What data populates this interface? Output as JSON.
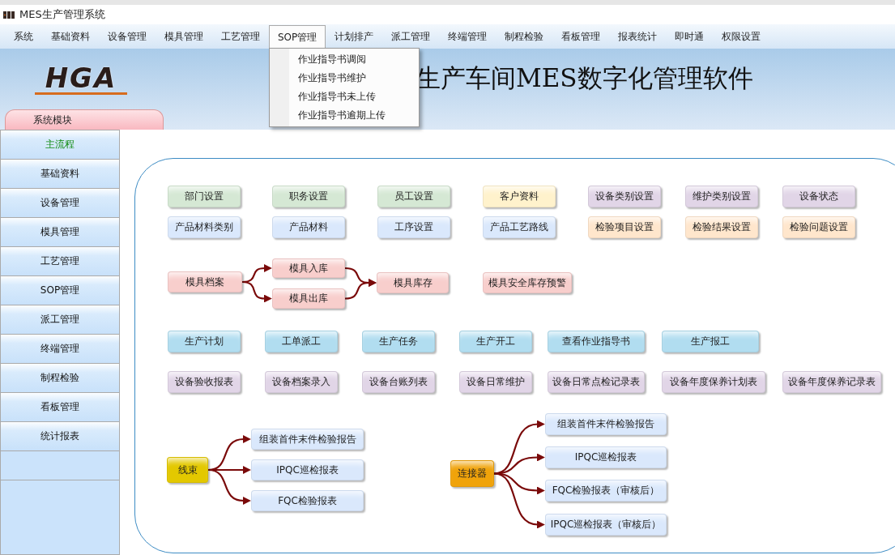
{
  "window": {
    "title": "MES生产管理系统"
  },
  "menu": [
    {
      "label": "系统",
      "selected": false
    },
    {
      "label": "基础资料",
      "selected": false
    },
    {
      "label": "设备管理",
      "selected": false
    },
    {
      "label": "模具管理",
      "selected": false
    },
    {
      "label": "工艺管理",
      "selected": false
    },
    {
      "label": "SOP管理",
      "selected": true
    },
    {
      "label": "计划排产",
      "selected": false
    },
    {
      "label": "派工管理",
      "selected": false
    },
    {
      "label": "终端管理",
      "selected": false
    },
    {
      "label": "制程检验",
      "selected": false
    },
    {
      "label": "看板管理",
      "selected": false
    },
    {
      "label": "报表统计",
      "selected": false
    },
    {
      "label": "即时通",
      "selected": false
    },
    {
      "label": "权限设置",
      "selected": false
    }
  ],
  "dropdown": [
    "作业指导书调阅",
    "作业指导书维护",
    "作业指导书未上传",
    "作业指导书逾期上传"
  ],
  "banner": {
    "logo": "HGA",
    "title": "生产车间MES数字化管理软件"
  },
  "module_tab": "系统模块",
  "sidebar": [
    {
      "label": "主流程",
      "selected": true
    },
    {
      "label": "基础资料",
      "selected": false
    },
    {
      "label": "设备管理",
      "selected": false
    },
    {
      "label": "模具管理",
      "selected": false
    },
    {
      "label": "工艺管理",
      "selected": false
    },
    {
      "label": "SOP管理",
      "selected": false
    },
    {
      "label": "派工管理",
      "selected": false
    },
    {
      "label": "终端管理",
      "selected": false
    },
    {
      "label": "制程检验",
      "selected": false
    },
    {
      "label": "看板管理",
      "selected": false
    },
    {
      "label": "统计报表",
      "selected": false
    }
  ],
  "grid_rows": [
    [
      {
        "label": "部门设置",
        "color": "#d5e8d4"
      },
      {
        "label": "职务设置",
        "color": "#d5e8d4"
      },
      {
        "label": "员工设置",
        "color": "#d5e8d4"
      },
      {
        "label": "客户资料",
        "color": "#fff2cc"
      },
      {
        "label": "设备类别设置",
        "color": "#e1d5e7"
      },
      {
        "label": "维护类别设置",
        "color": "#e1d5e7"
      },
      {
        "label": "设备状态",
        "color": "#e1d5e7"
      }
    ],
    [
      {
        "label": "产品材料类别",
        "color": "#dae8fc"
      },
      {
        "label": "产品材料",
        "color": "#dae8fc"
      },
      {
        "label": "工序设置",
        "color": "#dae8fc"
      },
      {
        "label": "产品工艺路线",
        "color": "#dae8fc"
      },
      {
        "label": "检验项目设置",
        "color": "#ffe6cc"
      },
      {
        "label": "检验结果设置",
        "color": "#ffe6cc"
      },
      {
        "label": "检验问题设置",
        "color": "#ffe6cc"
      }
    ],
    [
      {
        "label": "生产计划",
        "color": "#b1ddf0"
      },
      {
        "label": "工单派工",
        "color": "#b1ddf0"
      },
      {
        "label": "生产任务",
        "color": "#b1ddf0"
      },
      {
        "label": "生产开工",
        "color": "#b1ddf0"
      },
      {
        "label": "查看作业指导书",
        "color": "#b1ddf0"
      },
      {
        "label": "生产报工",
        "color": "#b1ddf0"
      }
    ],
    [
      {
        "label": "设备验收报表",
        "color": "#e1d5e7"
      },
      {
        "label": "设备档案录入",
        "color": "#e1d5e7"
      },
      {
        "label": "设备台账列表",
        "color": "#e1d5e7"
      },
      {
        "label": "设备日常维护",
        "color": "#e1d5e7"
      },
      {
        "label": "设备日常点检记录表",
        "color": "#e1d5e7"
      },
      {
        "label": "设备年度保养计划表",
        "color": "#e1d5e7"
      },
      {
        "label": "设备年度保养记录表",
        "color": "#e1d5e7"
      }
    ]
  ],
  "mold_flow": [
    {
      "label": "模具档案",
      "color": "#f8cecc"
    },
    {
      "label": "模具入库",
      "color": "#f8cecc"
    },
    {
      "label": "模具出库",
      "color": "#f8cecc"
    },
    {
      "label": "模具库存",
      "color": "#f8cecc"
    },
    {
      "label": "模具安全库存预警",
      "color": "#f8cecc"
    }
  ],
  "trees": [
    {
      "root": {
        "label": "线束",
        "color": "#e3c800"
      },
      "children": [
        "组装首件末件检验报告",
        "IPQC巡检报表",
        "FQC检验报表"
      ]
    },
    {
      "root": {
        "label": "连接器",
        "color": "#f0a30a"
      },
      "children": [
        "组装首件末件检验报告",
        "IPQC巡检报表",
        "FQC检验报表（审核后）",
        "IPQC巡检报表（审核后）"
      ]
    }
  ]
}
